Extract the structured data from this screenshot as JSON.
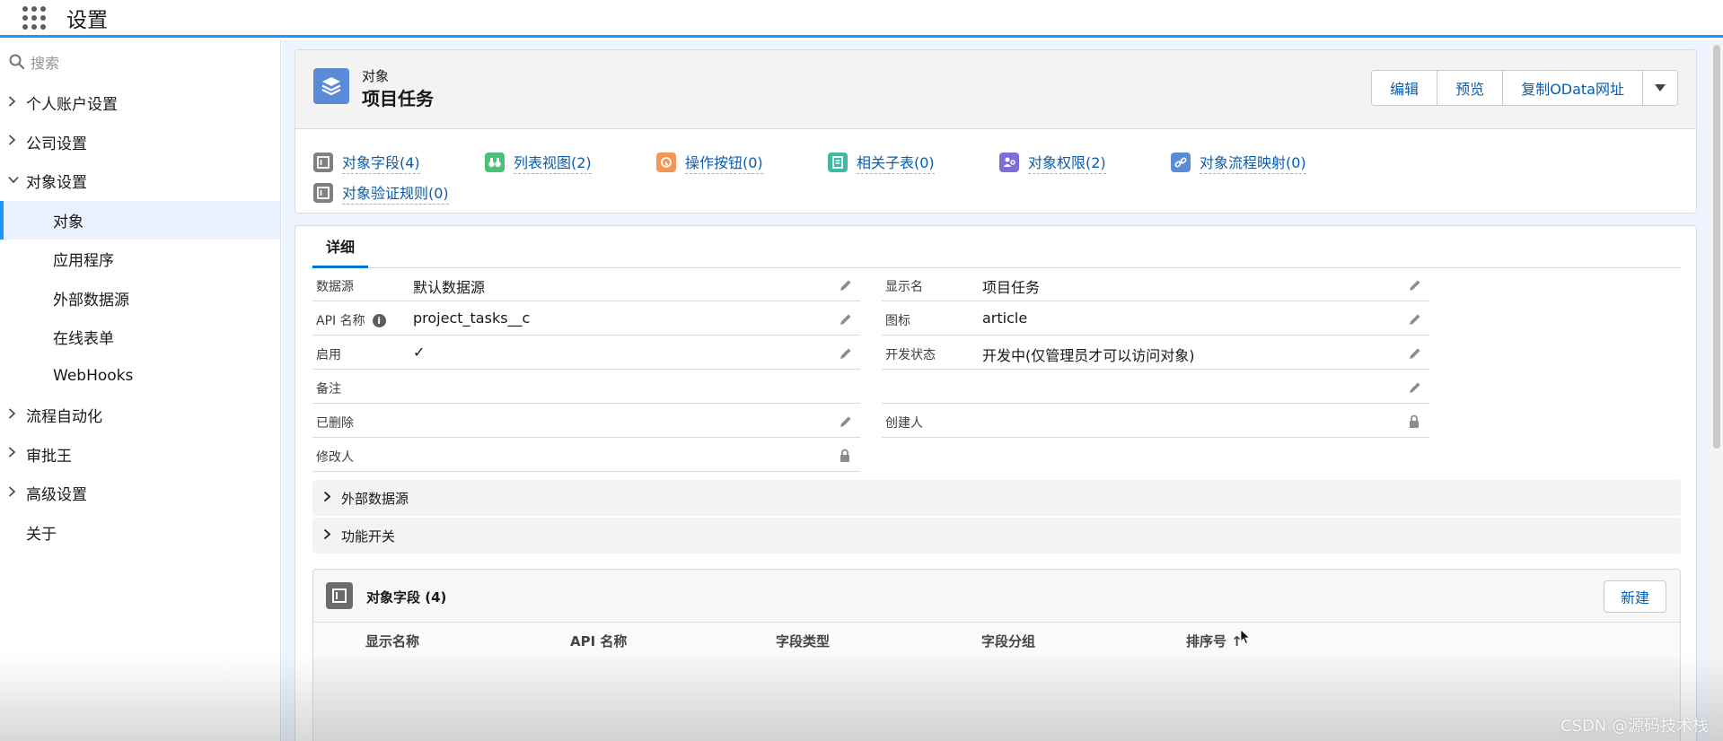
{
  "app": {
    "title": "设置"
  },
  "sidebar": {
    "search_placeholder": "搜索",
    "items": [
      {
        "label": "个人账户设置",
        "expandable": true,
        "expanded": false
      },
      {
        "label": "公司设置",
        "expandable": true,
        "expanded": false
      },
      {
        "label": "对象设置",
        "expandable": true,
        "expanded": true
      },
      {
        "label": "对象",
        "child": true,
        "active": true
      },
      {
        "label": "应用程序",
        "child": true
      },
      {
        "label": "外部数据源",
        "child": true
      },
      {
        "label": "在线表单",
        "child": true
      },
      {
        "label": "WebHooks",
        "child": true
      },
      {
        "label": "流程自动化",
        "expandable": true,
        "expanded": false
      },
      {
        "label": "审批王",
        "expandable": true,
        "expanded": false
      },
      {
        "label": "高级设置",
        "expandable": true,
        "expanded": false
      },
      {
        "label": "关于",
        "expandable": false
      }
    ]
  },
  "header": {
    "object_type": "对象",
    "object_name": "项目任务",
    "buttons": {
      "edit": "编辑",
      "preview": "预览",
      "copy_odata": "复制OData网址"
    }
  },
  "related_links": [
    {
      "label": "对象字段(4)",
      "icon": "field-icon",
      "color": "#7f8082"
    },
    {
      "label": "列表视图(2)",
      "icon": "binoculars-icon",
      "color": "#4bc076"
    },
    {
      "label": "操作按钮(0)",
      "icon": "action-button-icon",
      "color": "#f49756"
    },
    {
      "label": "相关子表(0)",
      "icon": "related-list-icon",
      "color": "#3fb9a3"
    },
    {
      "label": "对象权限(2)",
      "icon": "permission-icon",
      "color": "#7f6cd6"
    },
    {
      "label": "对象流程映射(0)",
      "icon": "link-icon",
      "color": "#5a8bd6"
    },
    {
      "label": "对象验证规则(0)",
      "icon": "validation-rule-icon",
      "color": "#7f8082"
    }
  ],
  "detail": {
    "tab_label": "详细",
    "left_fields": [
      {
        "label": "数据源",
        "value": "默认数据源",
        "action": "edit"
      },
      {
        "label": "API 名称",
        "value": "project_tasks__c",
        "action": "edit",
        "info": true
      },
      {
        "label": "启用",
        "value": "✓",
        "action": "edit"
      },
      {
        "label": "备注",
        "value": "",
        "action": "none"
      },
      {
        "label": "已删除",
        "value": "",
        "action": "edit"
      },
      {
        "label": "修改人",
        "value": "",
        "action": "lock"
      }
    ],
    "right_fields": [
      {
        "label": "显示名",
        "value": "项目任务",
        "action": "edit"
      },
      {
        "label": "图标",
        "value": "article",
        "action": "edit"
      },
      {
        "label": "开发状态",
        "value": "开发中(仅管理员才可以访问对象)",
        "action": "edit"
      },
      {
        "label": "",
        "value": "",
        "action": "edit"
      },
      {
        "label": "创建人",
        "value": "",
        "action": "lock"
      }
    ],
    "sections": [
      {
        "label": "外部数据源"
      },
      {
        "label": "功能开关"
      }
    ]
  },
  "field_list": {
    "title": "对象字段 (4)",
    "new_button": "新建",
    "columns": [
      "显示名称",
      "API 名称",
      "字段类型",
      "字段分组",
      "排序号 ↑"
    ]
  },
  "watermark": "CSDN @源码技术栈",
  "colors": {
    "accent": "#1b96ff",
    "link": "#0b5cab",
    "object_icon": "#5a8bd6"
  }
}
